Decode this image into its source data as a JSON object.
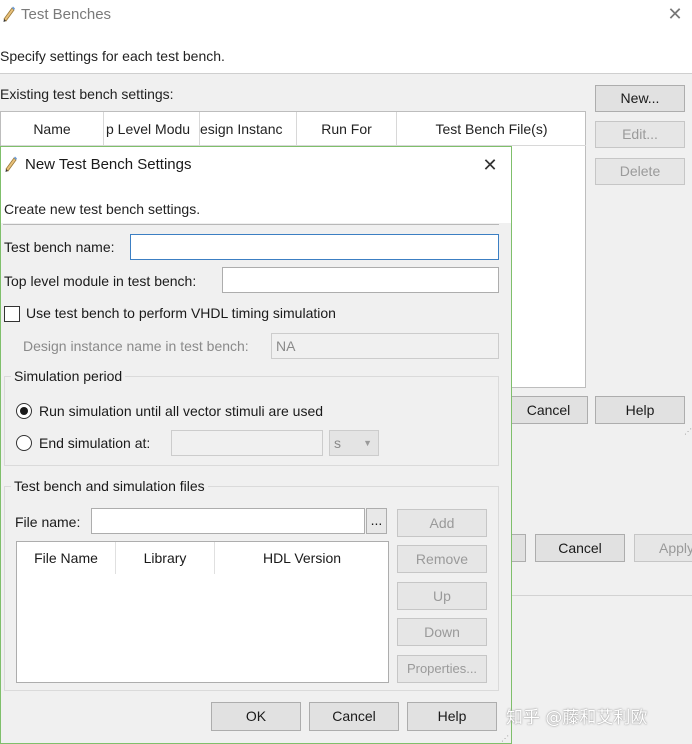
{
  "background_dialog": {
    "title": "Test Benches",
    "subtitle": "Specify settings for each test bench.",
    "existing_label": "Existing test bench settings:",
    "table_columns": [
      "Name",
      "p Level Modu",
      "esign Instanc",
      "Run For",
      "Test Bench File(s)"
    ],
    "buttons": {
      "new": "New...",
      "edit": "Edit...",
      "delete": "Delete",
      "cancel": "Cancel",
      "help": "Help"
    },
    "footer_buttons": {
      "cancel": "Cancel",
      "apply": "Apply"
    }
  },
  "dialog": {
    "title": "New Test Bench Settings",
    "subtitle": "Create new test bench settings.",
    "test_bench_name_label": "Test bench name:",
    "test_bench_name_value": "",
    "top_level_module_label": "Top level module in test bench:",
    "top_level_module_value": "",
    "vhdl_checkbox_label": "Use test bench to perform VHDL timing simulation",
    "vhdl_checkbox_checked": false,
    "design_instance_label": "Design instance name in test bench:",
    "design_instance_value": "NA",
    "simulation_period": {
      "title": "Simulation period",
      "run_until_label": "Run simulation until all vector stimuli are used",
      "end_at_label": "End simulation at:",
      "end_at_value": "",
      "unit": "s",
      "selected": "run_until"
    },
    "files": {
      "title": "Test bench and simulation files",
      "file_name_label": "File name:",
      "file_name_value": "",
      "browse_label": "...",
      "columns": [
        "File Name",
        "Library",
        "HDL Version"
      ],
      "buttons": {
        "add": "Add",
        "remove": "Remove",
        "up": "Up",
        "down": "Down",
        "properties": "Properties..."
      }
    },
    "footer": {
      "ok": "OK",
      "cancel": "Cancel",
      "help": "Help"
    }
  },
  "watermark": "知乎 @藤和艾利欧",
  "colors": {
    "focus_border": "#3c7fc3",
    "dialog_border": "#7fbf6b",
    "window_bg": "#f0f0f0"
  }
}
